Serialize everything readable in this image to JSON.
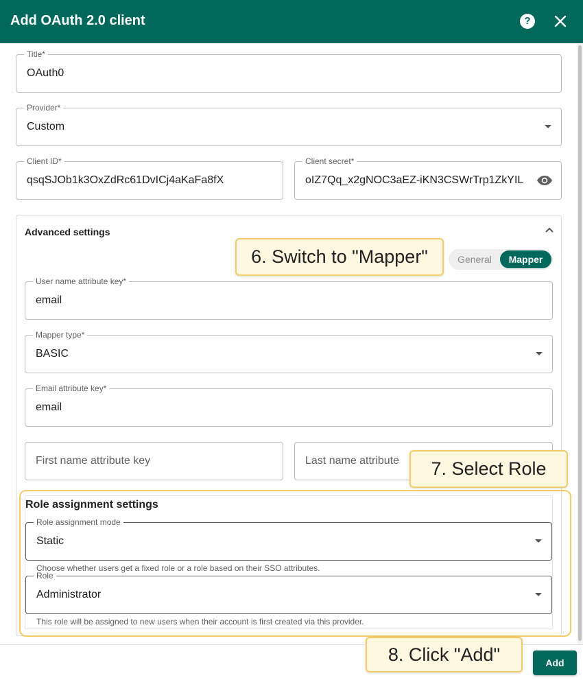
{
  "dialog": {
    "title": "Add OAuth 2.0 client",
    "help_icon": "?"
  },
  "form": {
    "title": {
      "label": "Title*",
      "value": "OAuth0"
    },
    "provider": {
      "label": "Provider*",
      "value": "Custom"
    },
    "client_id": {
      "label": "Client ID*",
      "value": "qsqSJOb1k3OxZdRc61DvICj4aKaFa8fX"
    },
    "client_secret": {
      "label": "Client secret*",
      "value": "oIZ7Qq_x2gNOC3aEZ-iKN3CSWrTrp1ZkYIL"
    }
  },
  "advanced": {
    "title": "Advanced settings",
    "toggle": {
      "general": "General",
      "mapper": "Mapper",
      "selected": "Mapper"
    },
    "user_name_key": {
      "label": "User name attribute key*",
      "value": "email"
    },
    "mapper_type": {
      "label": "Mapper type*",
      "value": "BASIC"
    },
    "email_key": {
      "label": "Email attribute key*",
      "value": "email"
    },
    "first_name_key": {
      "placeholder": "First name attribute key"
    },
    "last_name_key": {
      "placeholder": "Last name attribute"
    }
  },
  "role_settings": {
    "title": "Role assignment settings",
    "mode": {
      "label": "Role assignment mode",
      "value": "Static",
      "helper": "Choose whether users get a fixed role or a role based on their SSO attributes."
    },
    "role": {
      "label": "Role",
      "value": "Administrator",
      "helper": "This role will be assigned to new users when their account is first created via this provider."
    }
  },
  "footer": {
    "add_label": "Add"
  },
  "callouts": {
    "step6": "6. Switch to \"Mapper\"",
    "step7": "7. Select Role",
    "step8": "8. Click \"Add\""
  },
  "colors": {
    "primary": "#00695c",
    "callout_border": "#f3cc6a",
    "callout_bg": "#fff8e1"
  }
}
